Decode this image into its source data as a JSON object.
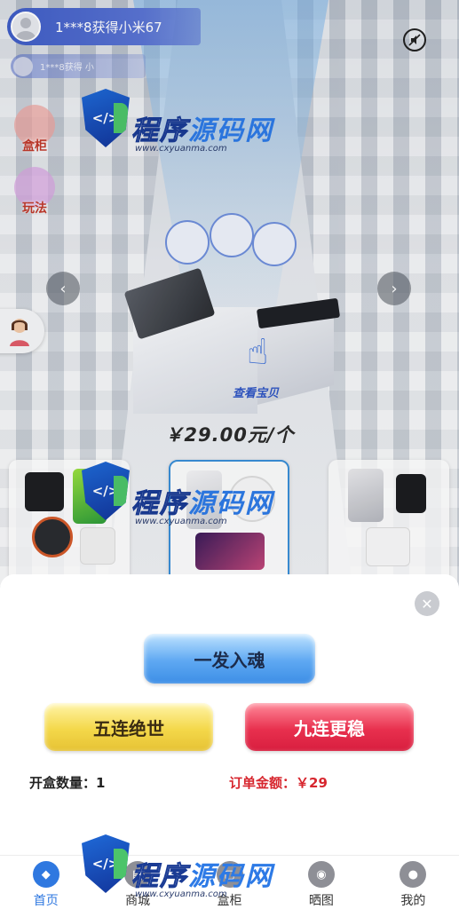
{
  "ticker": {
    "primary": "1***8获得小米67",
    "secondary": "1***8获得 小"
  },
  "side": {
    "cabinet_label": "盒柜",
    "play_label": "玩法"
  },
  "banner": {
    "look_label": "查看宝贝",
    "price": "￥29.00元/个"
  },
  "watermark": {
    "title_a": "程序",
    "title_b": "源码网",
    "url": "www.cxyuanma.com"
  },
  "sheet": {
    "btn_one": "一发入魂",
    "btn_five": "五连绝世",
    "btn_nine": "九连更稳",
    "quantity": "开盒数量：1",
    "amount": "订单金额：￥29"
  },
  "tabs": [
    {
      "label": "首页",
      "icon": "home-icon"
    },
    {
      "label": "商城",
      "icon": "shop-icon"
    },
    {
      "label": "盒柜",
      "icon": "box-icon"
    },
    {
      "label": "晒图",
      "icon": "camera-icon"
    },
    {
      "label": "我的",
      "icon": "user-icon"
    }
  ],
  "colors": {
    "accent": "#2f78e0",
    "amount_red": "#d7262e"
  }
}
